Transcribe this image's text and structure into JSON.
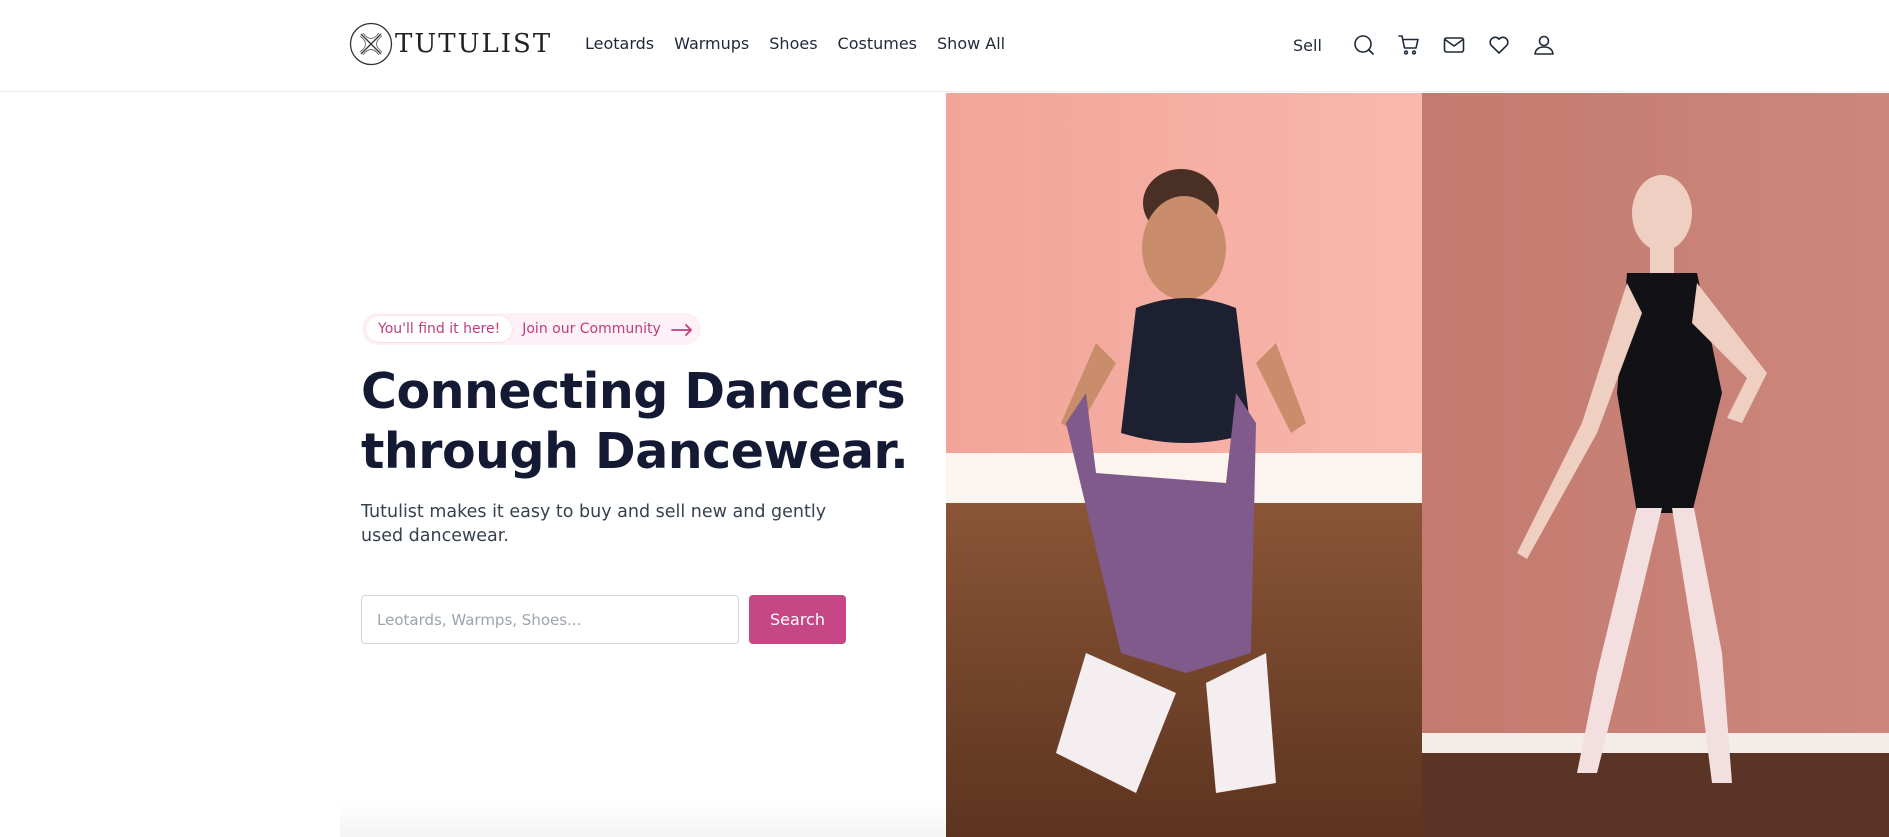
{
  "brand": {
    "name": "TUTULIST",
    "logo_icon": "x-circle-logo"
  },
  "nav": {
    "items": [
      {
        "label": "Leotards"
      },
      {
        "label": "Warmups"
      },
      {
        "label": "Shoes"
      },
      {
        "label": "Costumes"
      },
      {
        "label": "Show All"
      }
    ]
  },
  "actions": {
    "sell_label": "Sell",
    "icons": [
      "search-icon",
      "cart-icon",
      "mail-icon",
      "heart-icon",
      "user-icon"
    ]
  },
  "hero": {
    "badge": "You'll find it here!",
    "community_link": "Join our Community",
    "headline_line1": "Connecting Dancers",
    "headline_line2": "through Dancewear.",
    "subtext": "Tutulist makes it easy to buy and sell new and gently used dancewear.",
    "search": {
      "placeholder": "Leotards, Warmps, Shoes...",
      "value": "",
      "button_label": "Search"
    }
  },
  "colors": {
    "accent": "#c74786",
    "accent_text": "#be3d7d",
    "pill_bg": "#fdf0f6",
    "headline": "#141a33",
    "photo_left_wall": "#f4a99d",
    "photo_right_wall": "#c87f74",
    "floor": "#6b3f28"
  }
}
